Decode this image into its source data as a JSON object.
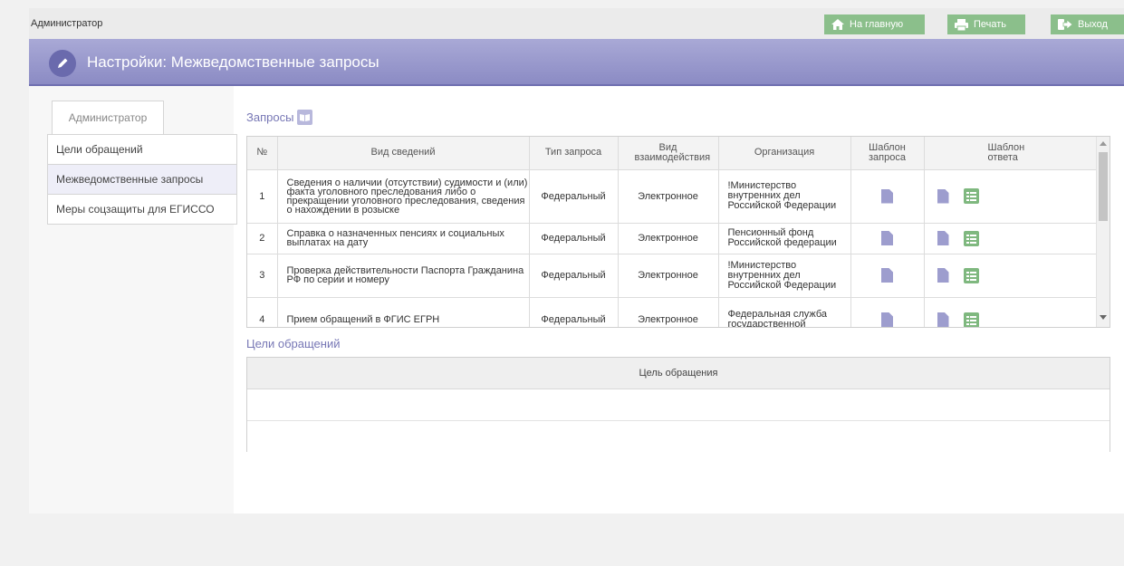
{
  "header": {
    "user": "Администратор",
    "buttons": {
      "home": "На главную",
      "print": "Печать",
      "exit": "Выход"
    }
  },
  "title": "Настройки: Межведомственные запросы",
  "sidebar": {
    "tab": "Администратор",
    "items": [
      {
        "label": "Цели обращений",
        "active": false
      },
      {
        "label": "Межведомственные запросы",
        "active": true
      },
      {
        "label": "Меры соцзащиты для ЕГИССО",
        "active": false
      }
    ]
  },
  "requests": {
    "title": "Запросы",
    "columns": [
      "№",
      "Вид сведений",
      "Тип запроса",
      "Вид взаимодействия",
      "Организация",
      "Шаблон запроса",
      "Шаблон ответа"
    ],
    "rows": [
      {
        "num": "1",
        "kind": "Сведения о наличии (отсутствии) судимости и (или) факта уголовного преследования либо о прекращении уголовного преследования, сведения о нахождении в розыске",
        "type": "Федеральный",
        "interaction": "Электронное",
        "org": "!Министерство внутренних дел Российской Федерации"
      },
      {
        "num": "2",
        "kind": "Справка о назначенных пенсиях и социальных выплатах на дату",
        "type": "Федеральный",
        "interaction": "Электронное",
        "org": "Пенсионный фонд Российской федерации"
      },
      {
        "num": "3",
        "kind": "Проверка действительности Паспорта Гражданина РФ по серии и номеру",
        "type": "Федеральный",
        "interaction": "Электронное",
        "org": "!Министерство внутренних дел Российской Федерации"
      },
      {
        "num": "4",
        "kind": "Прием обращений в ФГИС ЕГРН",
        "type": "Федеральный",
        "interaction": "Электронное",
        "org": "Федеральная служба государственной"
      }
    ]
  },
  "goals": {
    "title": "Цели обращений",
    "column": "Цель обращения"
  },
  "colors": {
    "accent": "#8b8bc4",
    "button": "#8bbf8b",
    "icon_doc": "#9d9dce"
  }
}
